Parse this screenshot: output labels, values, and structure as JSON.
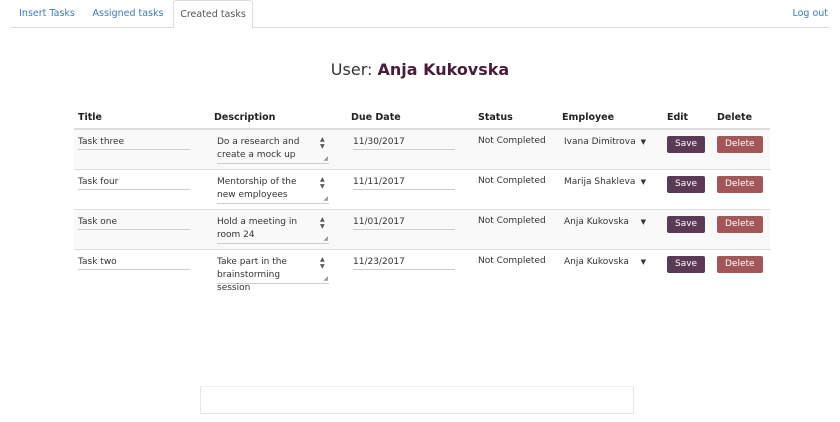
{
  "nav": {
    "tabs": [
      {
        "label": "Insert Tasks"
      },
      {
        "label": "Assigned tasks"
      },
      {
        "label": "Created tasks"
      }
    ],
    "logout": "Log out"
  },
  "user": {
    "prefix": "User:",
    "name": "Anja Kukovska"
  },
  "table": {
    "headers": [
      "Title",
      "Description",
      "Due Date",
      "Status",
      "Employee",
      "Edit",
      "Delete"
    ],
    "rows": [
      {
        "title": "Task three",
        "description": "Do a research and create a mock up",
        "due": "11/30/2017",
        "status": "Not Completed",
        "employee": "Ivana Dimitrova",
        "save": "Save",
        "delete": "Delete"
      },
      {
        "title": "Task four",
        "description": "Mentorship of the new employees",
        "due": "11/11/2017",
        "status": "Not Completed",
        "employee": "Marija Shakleva",
        "save": "Save",
        "delete": "Delete"
      },
      {
        "title": "Task one",
        "description": "Hold a meeting in room 24",
        "due": "11/01/2017",
        "status": "Not Completed",
        "employee": "Anja Kukovska",
        "save": "Save",
        "delete": "Delete"
      },
      {
        "title": "Task two",
        "description": "Take part in the brainstorming session",
        "due": "11/23/2017",
        "status": "Not Completed",
        "employee": "Anja Kukovska",
        "save": "Save",
        "delete": "Delete"
      }
    ]
  },
  "colors": {
    "link": "#3c7bb8",
    "user_name": "#4a1c3a",
    "save_button": "#5c3a56",
    "delete_button": "#a25657"
  }
}
